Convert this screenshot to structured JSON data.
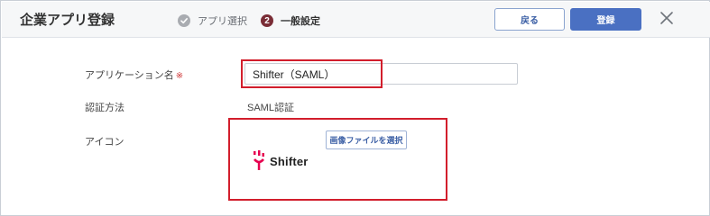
{
  "header": {
    "title": "企業アプリ登録",
    "steps": [
      {
        "number": "",
        "label": "アプリ選択",
        "state": "done"
      },
      {
        "number": "2",
        "label": "一般設定",
        "state": "current"
      }
    ],
    "back_label": "戻る",
    "register_label": "登録",
    "close_icon": "close-icon"
  },
  "form": {
    "app_name_label": "アプリケーション名",
    "required_mark": "※",
    "app_name_value": "Shifter（SAML）",
    "auth_label": "認証方法",
    "auth_value": "SAML認証",
    "icon_label": "アイコン",
    "select_image_label": "画像ファイルを選択",
    "logo_text": "Shifter"
  },
  "colors": {
    "accent": "#4a70c2",
    "highlight": "#d21e2c",
    "step_current": "#7a2d36",
    "step_done": "#a9acb1",
    "logo_mark": "#e6004f"
  }
}
